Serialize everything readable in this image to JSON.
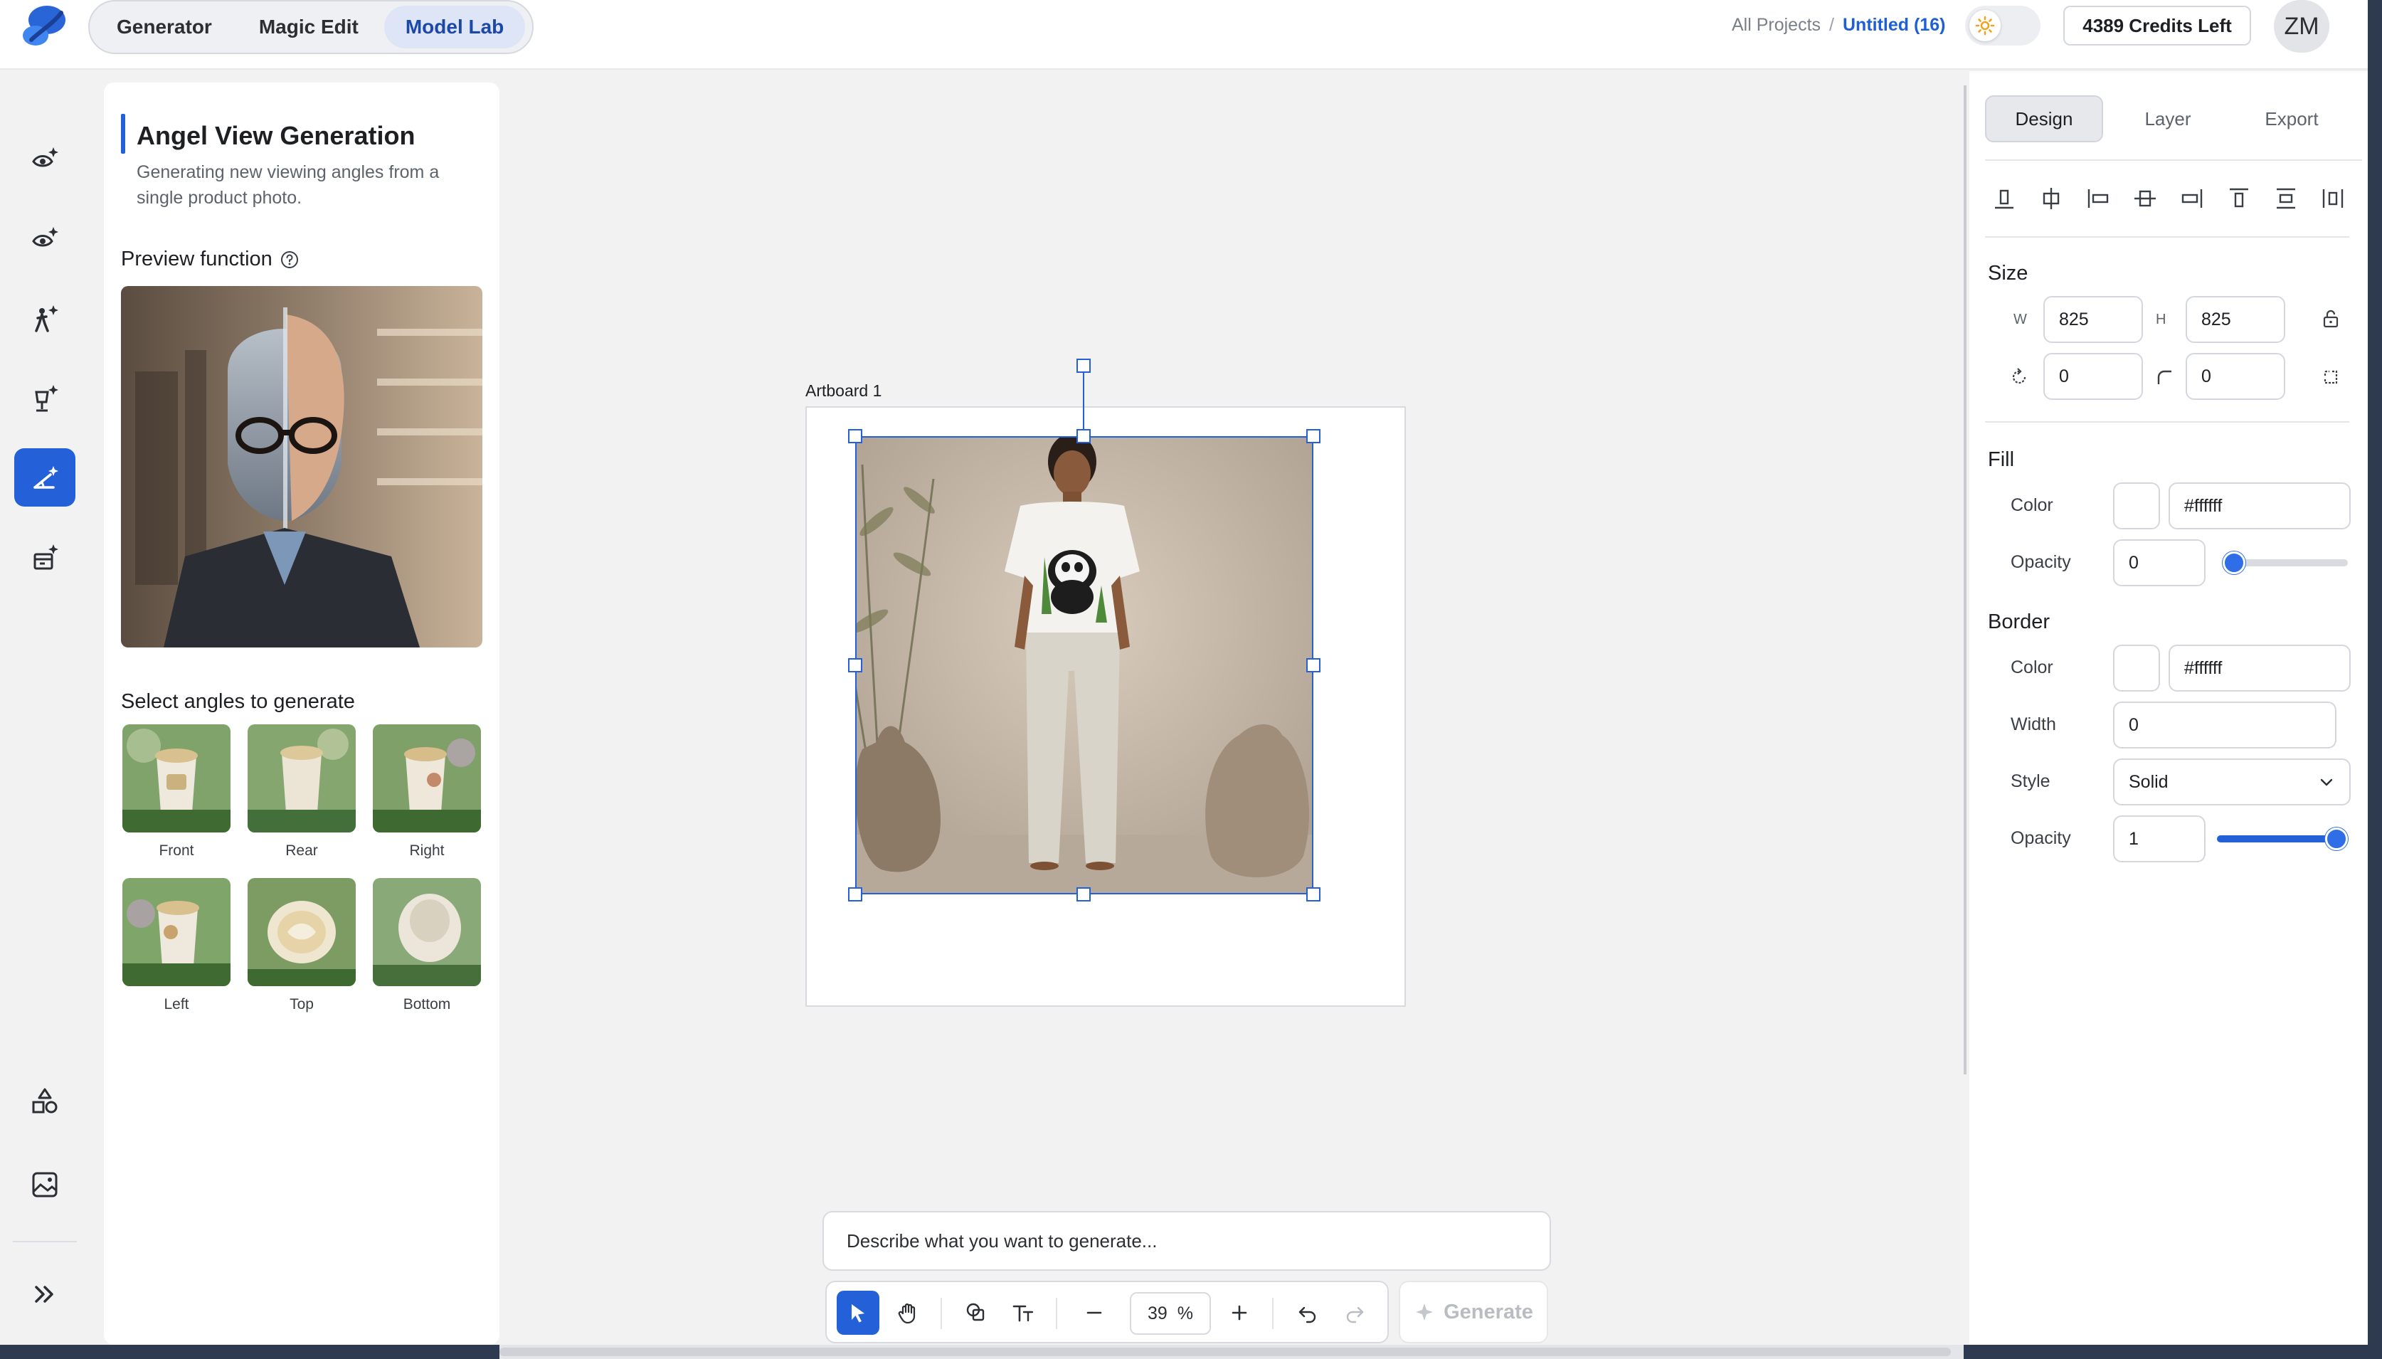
{
  "header": {
    "mode_tabs": [
      {
        "label": "Generator",
        "active": false
      },
      {
        "label": "Magic Edit",
        "active": false
      },
      {
        "label": "Model Lab",
        "active": true
      }
    ],
    "breadcrumb": {
      "root": "All Projects",
      "separator": "/",
      "current": "Untitled (16)"
    },
    "credits": "4389 Credits Left",
    "avatar_initials": "ZM"
  },
  "rail": {
    "items": [
      {
        "icon": "eye-sparkle-icon"
      },
      {
        "icon": "eye-sparkle-icon"
      },
      {
        "icon": "figure-sparkle-icon"
      },
      {
        "icon": "mannequin-sparkle-icon"
      },
      {
        "icon": "angle-sparkle-icon",
        "active": true
      },
      {
        "icon": "box-sparkle-icon"
      },
      {
        "icon": "shapes-icon"
      },
      {
        "icon": "image-icon"
      },
      {
        "icon": "expand-chevrons-icon"
      }
    ]
  },
  "left_panel": {
    "title": "Angel View Generation",
    "description": "Generating new viewing angles from a single product photo.",
    "preview_label": "Preview function",
    "angles_label": "Select angles to generate",
    "angles": [
      {
        "label": "Front"
      },
      {
        "label": "Rear"
      },
      {
        "label": "Right"
      },
      {
        "label": "Left"
      },
      {
        "label": "Top"
      },
      {
        "label": "Bottom"
      }
    ]
  },
  "canvas": {
    "artboard_label": "Artboard 1",
    "prompt_placeholder": "Describe what you want to generate...",
    "zoom_value": "39",
    "zoom_unit": "%",
    "generate_label": "Generate"
  },
  "right_panel": {
    "tabs": [
      {
        "label": "Design",
        "active": true
      },
      {
        "label": "Layer",
        "active": false
      },
      {
        "label": "Export",
        "active": false
      }
    ],
    "size": {
      "title": "Size",
      "w_label": "W",
      "w_value": "825",
      "h_label": "H",
      "h_value": "825",
      "rotation_value": "0",
      "radius_value": "0"
    },
    "fill": {
      "title": "Fill",
      "color_label": "Color",
      "color_value": "#ffffff",
      "opacity_label": "Opacity",
      "opacity_value": "0",
      "opacity_level": 0
    },
    "border": {
      "title": "Border",
      "color_label": "Color",
      "color_value": "#ffffff",
      "width_label": "Width",
      "width_value": "0",
      "style_label": "Style",
      "style_value": "Solid",
      "opacity_label": "Opacity",
      "opacity_value": "1",
      "opacity_level": 1
    }
  },
  "colors": {
    "accent": "#2461d8",
    "breadcrumb_active": "#1f5fd6",
    "mode_tab_active_bg": "#dde5f7"
  }
}
